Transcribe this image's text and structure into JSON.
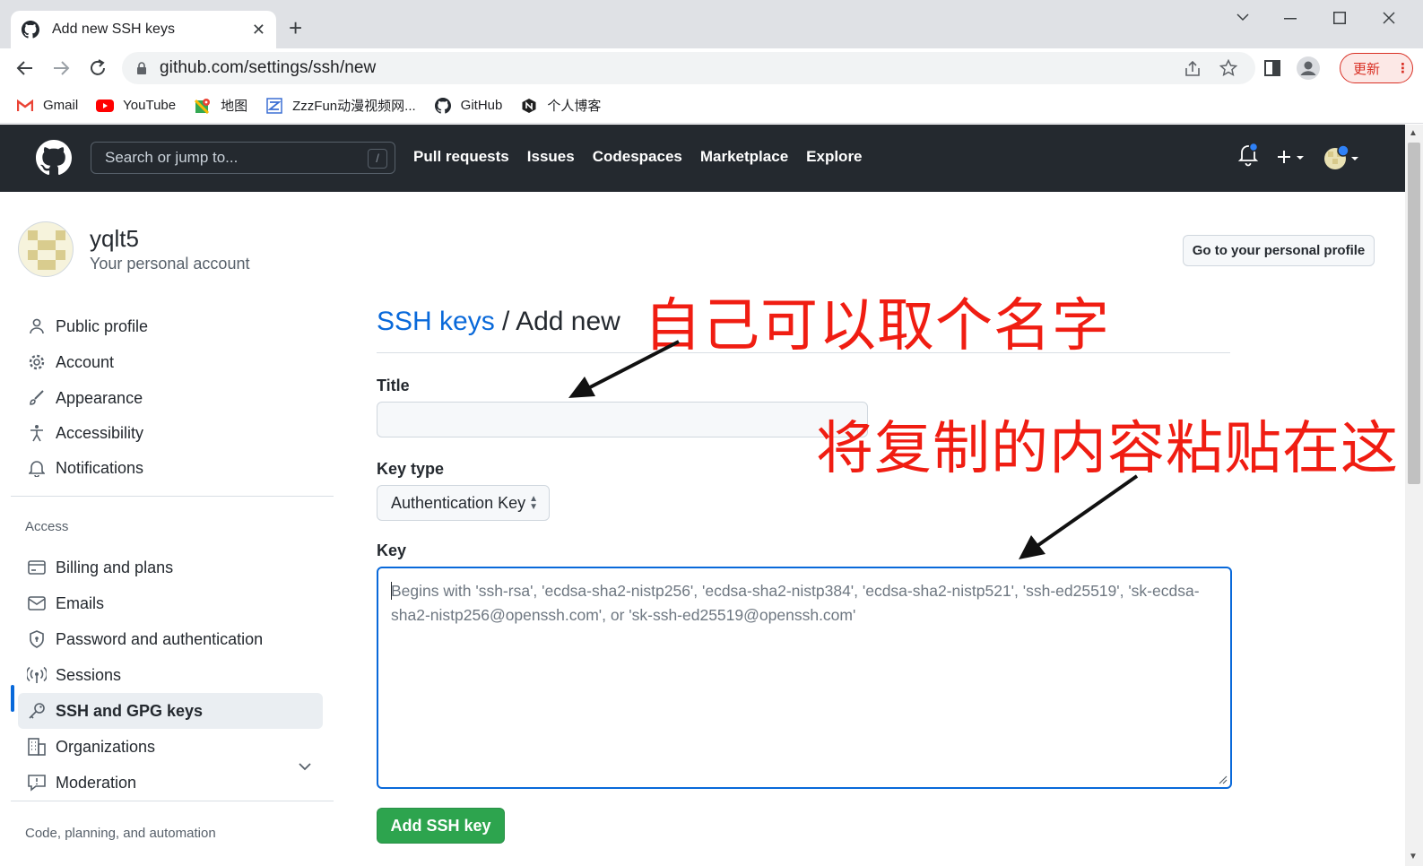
{
  "browser": {
    "tab_title": "Add new SSH keys",
    "tab_close": "✕",
    "new_tab": "+",
    "url": "github.com/settings/ssh/new",
    "update_label": "更新",
    "bookmarks": [
      {
        "label": "Gmail",
        "icon": "gmail-icon"
      },
      {
        "label": "YouTube",
        "icon": "youtube-icon"
      },
      {
        "label": "地图",
        "icon": "maps-icon"
      },
      {
        "label": "ZzzFun动漫视频网...",
        "icon": "zzzfun-icon"
      },
      {
        "label": "GitHub",
        "icon": "github-icon"
      },
      {
        "label": "个人博客",
        "icon": "blog-icon"
      }
    ]
  },
  "header": {
    "search_placeholder": "Search or jump to...",
    "search_shortcut": "/",
    "nav": [
      "Pull requests",
      "Issues",
      "Codespaces",
      "Marketplace",
      "Explore"
    ]
  },
  "profile": {
    "name": "yqlt5",
    "subtitle": "Your personal account",
    "profile_button": "Go to your personal profile"
  },
  "sidebar": {
    "group1": [
      {
        "label": "Public profile",
        "icon": "person-icon"
      },
      {
        "label": "Account",
        "icon": "gear-icon"
      },
      {
        "label": "Appearance",
        "icon": "paintbrush-icon"
      },
      {
        "label": "Accessibility",
        "icon": "accessibility-icon"
      },
      {
        "label": "Notifications",
        "icon": "bell-icon"
      }
    ],
    "access_heading": "Access",
    "group2": [
      {
        "label": "Billing and plans",
        "icon": "credit-card-icon"
      },
      {
        "label": "Emails",
        "icon": "mail-icon"
      },
      {
        "label": "Password and authentication",
        "icon": "shield-lock-icon"
      },
      {
        "label": "Sessions",
        "icon": "broadcast-icon"
      },
      {
        "label": "SSH and GPG keys",
        "icon": "key-icon",
        "active": true
      },
      {
        "label": "Organizations",
        "icon": "organization-icon"
      },
      {
        "label": "Moderation",
        "icon": "report-icon"
      }
    ],
    "code_heading": "Code, planning, and automation"
  },
  "form": {
    "breadcrumb_link": "SSH keys",
    "breadcrumb_sep": " / ",
    "breadcrumb_current": "Add new",
    "title_label": "Title",
    "title_value": "",
    "key_type_label": "Key type",
    "key_type_value": "Authentication Key",
    "key_label": "Key",
    "key_placeholder": "Begins with 'ssh-rsa', 'ecdsa-sha2-nistp256', 'ecdsa-sha2-nistp384', 'ecdsa-sha2-nistp521', 'ssh-ed25519', 'sk-ecdsa-sha2-nistp256@openssh.com', or 'sk-ssh-ed25519@openssh.com'",
    "submit_label": "Add SSH key"
  },
  "annotations": {
    "title_note": "自己可以取个名字",
    "key_note": "将复制的内容粘贴在这",
    "color": "#f01d12"
  },
  "colors": {
    "header_bg": "#24292f",
    "link": "#0969da",
    "primary_button": "#2da44e",
    "focus_border": "#0969da"
  }
}
